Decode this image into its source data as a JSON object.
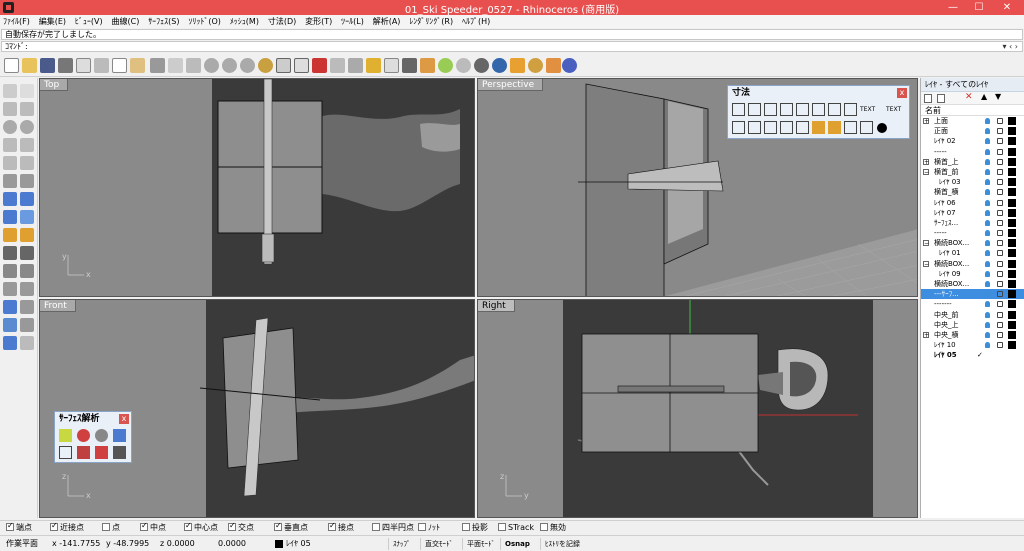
{
  "window": {
    "title": "01_Ski Speeder_0527 - Rhinoceros (商用版)",
    "minimize": "—",
    "maximize": "☐",
    "close": "✕"
  },
  "menu": [
    "ﾌｧｲﾙ(F)",
    "編集(E)",
    "ﾋﾞｭｰ(V)",
    "曲線(C)",
    "ｻｰﾌｪｽ(S)",
    "ｿﾘｯﾄﾞ(O)",
    "ﾒｯｼｭ(M)",
    "寸法(D)",
    "変形(T)",
    "ﾂｰﾙ(L)",
    "解析(A)",
    "ﾚﾝﾀﾞﾘﾝｸﾞ(R)",
    "ﾍﾙﾌﾟ(H)"
  ],
  "command": {
    "history": "自動保存が完了しました。",
    "prompt": "ｺﾏﾝﾄﾞ:",
    "arrows": "▾ ‹ ›"
  },
  "viewports": {
    "top": "Top",
    "perspective": "Perspective",
    "front": "Front",
    "right": "Right",
    "axis_x": "x",
    "axis_y": "y",
    "axis_z": "z"
  },
  "panels": {
    "dimension": {
      "title": "寸法",
      "close": "x",
      "text1": "TEXT",
      "text2": "TEXT"
    },
    "surface_analysis": {
      "title": "ｻｰﾌｪｽ解析",
      "close": "x"
    }
  },
  "layers": {
    "title": "ﾚｲﾔ - すべてのﾚｲﾔ",
    "close": "x",
    "header": "名前",
    "items": [
      {
        "name": "上面",
        "expander": "+"
      },
      {
        "name": "正面"
      },
      {
        "name": "ﾚｲﾔ 02"
      },
      {
        "name": "-----"
      },
      {
        "name": "横首_上",
        "expander": "+"
      },
      {
        "name": "横首_前",
        "expander": "−"
      },
      {
        "name": "ﾚｲﾔ 03",
        "indent": true
      },
      {
        "name": "横首_横"
      },
      {
        "name": "ﾚｲﾔ 06"
      },
      {
        "name": "ﾚｲﾔ 07"
      },
      {
        "name": "ｻｰﾌｪｽ..."
      },
      {
        "name": "-----"
      },
      {
        "name": "横続BOX...",
        "expander": "−"
      },
      {
        "name": "ﾚｲﾔ 01",
        "indent": true
      },
      {
        "name": "横続BOX...",
        "expander": "−"
      },
      {
        "name": "ﾚｲﾔ 09",
        "indent": true
      },
      {
        "name": "横続BOX..."
      },
      {
        "name": "---ｻｰﾌ...",
        "selected": true
      },
      {
        "name": "-------"
      },
      {
        "name": "中央_前"
      },
      {
        "name": "中央_上"
      },
      {
        "name": "中央_横",
        "expander": "+"
      },
      {
        "name": "ﾚｲﾔ 10"
      },
      {
        "name": "ﾚｲﾔ 05",
        "current": true,
        "check": "✓"
      }
    ]
  },
  "osnap": [
    {
      "label": "端点",
      "on": true
    },
    {
      "label": "近接点",
      "on": true
    },
    {
      "label": "点",
      "on": false
    },
    {
      "label": "中点",
      "on": true
    },
    {
      "label": "中心点",
      "on": true
    },
    {
      "label": "交点",
      "on": true
    },
    {
      "label": "垂直点",
      "on": true
    },
    {
      "label": "接点",
      "on": true
    },
    {
      "label": "四半円点",
      "on": false
    },
    {
      "label": "ﾉｯﾄ",
      "on": false
    },
    {
      "label": "投影",
      "on": false
    },
    {
      "label": "STrack",
      "on": false
    },
    {
      "label": "無効",
      "on": false
    }
  ],
  "status": {
    "cplane": "作業平面",
    "x": "x -141.7755",
    "y": "y -48.7995",
    "z": "z 0.0000",
    "value": "0.0000",
    "layer": "ﾚｲﾔ 05",
    "snap": "ｽﾅｯﾌﾟ",
    "ortho": "直交ﾓｰﾄﾞ",
    "planar": "平面ﾓｰﾄﾞ",
    "osnap": "Osnap",
    "history": "ﾋｽﾄﾘを記録"
  },
  "colors": {
    "titlebar": "#e8504f",
    "selected_layer": "#3d8de0",
    "viewport_bg": "#888888"
  }
}
